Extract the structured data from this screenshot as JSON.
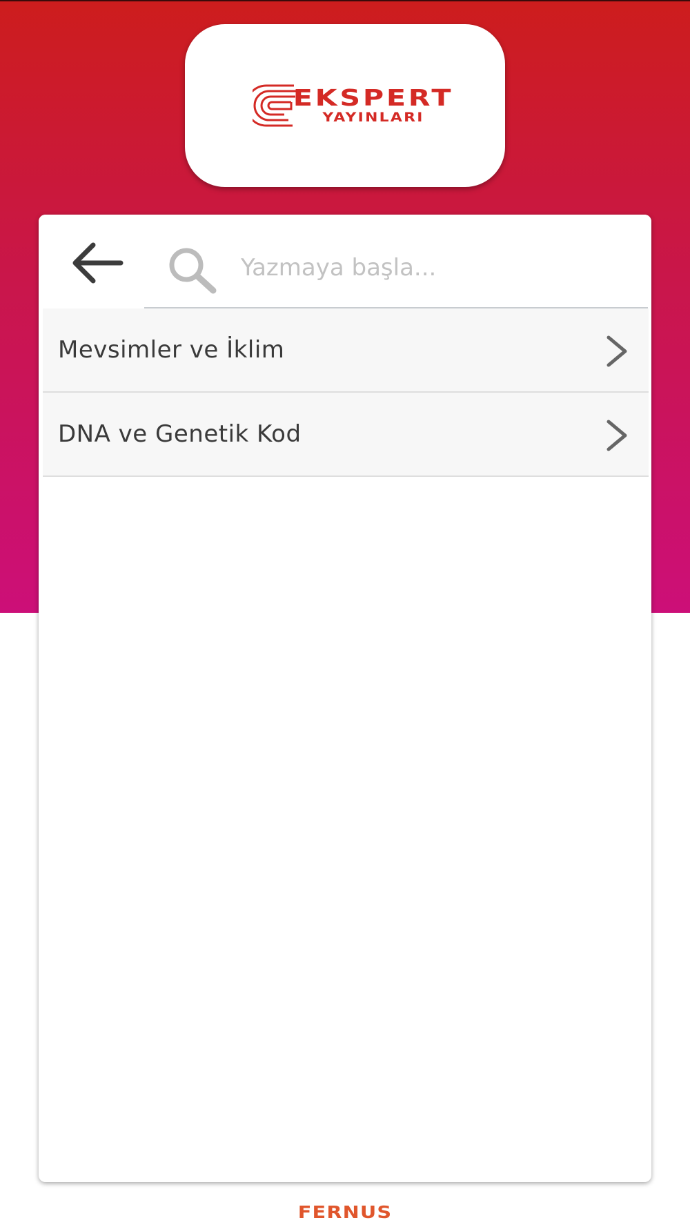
{
  "brand": {
    "name": "EKSPERT",
    "subtitle": "YAYINLARI",
    "color": "#d42a25"
  },
  "colors": {
    "gradient_top": "#cd1d1d",
    "gradient_bottom": "#cc0f78",
    "list_background": "#f7f7f7"
  },
  "search": {
    "placeholder": "Yazmaya başla...",
    "value": "",
    "icon": "search-icon"
  },
  "navigation": {
    "back_icon": "arrow-left-icon"
  },
  "topics": [
    {
      "label": "Mevsimler ve İklim",
      "icon": "chevron-right-icon"
    },
    {
      "label": "DNA ve Genetik Kod",
      "icon": "chevron-right-icon"
    }
  ],
  "footer": {
    "brand": "FERNUS"
  }
}
